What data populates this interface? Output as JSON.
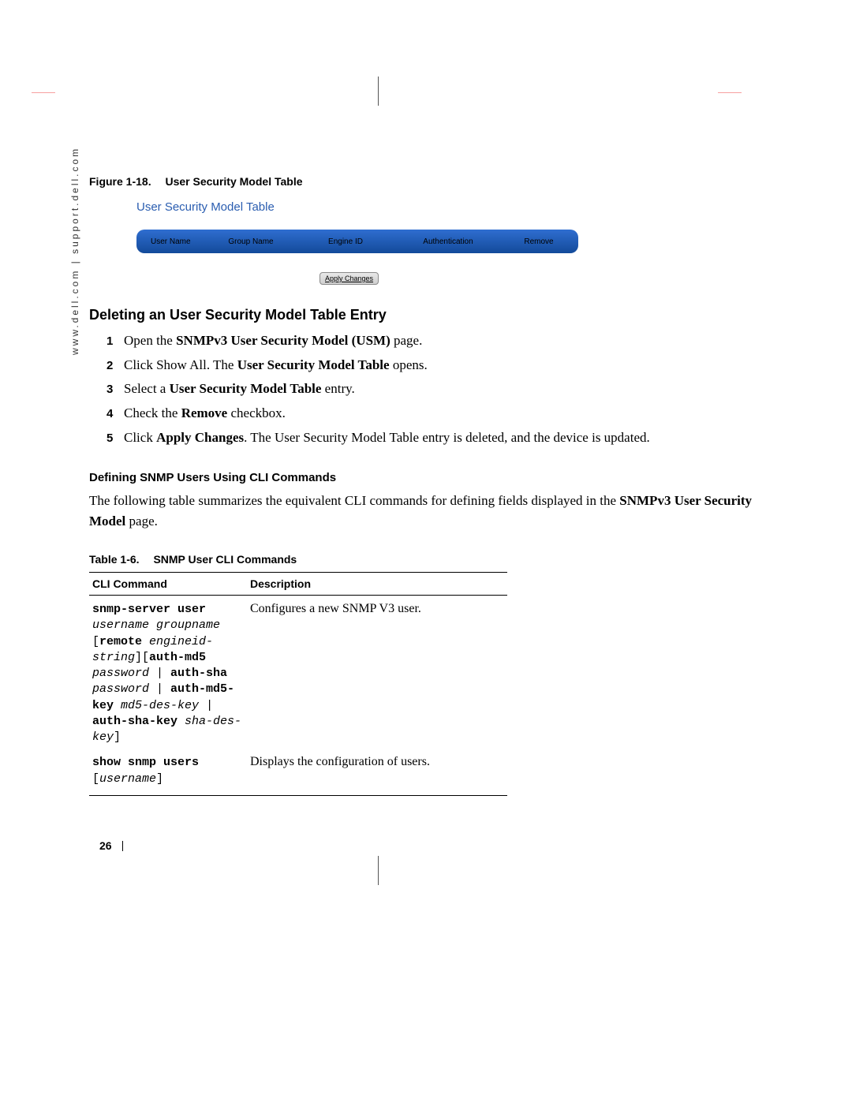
{
  "sidebar_url": "www.dell.com | support.dell.com",
  "figure": {
    "label": "Figure 1-18.",
    "title": "User Security Model Table",
    "panel_title": "User Security Model Table",
    "headers": {
      "user": "User Name",
      "group": "Group Name",
      "engine": "Engine ID",
      "auth": "Authentication",
      "remove": "Remove"
    },
    "apply_label": "Apply Changes"
  },
  "section_heading": "Deleting an User Security Model Table Entry",
  "steps": [
    {
      "n": "1",
      "pre": "Open the ",
      "bold": "SNMPv3 User Security Model (USM)",
      "post": " page."
    },
    {
      "n": "2",
      "pre": "Click Show All. The ",
      "bold": "User Security Model Table",
      "post": " opens."
    },
    {
      "n": "3",
      "pre": "Select a ",
      "bold": "User Security Model Table",
      "post": " entry."
    },
    {
      "n": "4",
      "pre": "Check the ",
      "bold": "Remove",
      "post": " checkbox."
    },
    {
      "n": "5",
      "pre": "Click ",
      "bold": "Apply Changes",
      "post": ". The User Security Model Table entry is deleted, and the device is updated."
    }
  ],
  "subheading": "Defining SNMP Users Using CLI Commands",
  "subpara_pre": "The following table summarizes the equivalent CLI commands for defining fields displayed in the ",
  "subpara_bold": "SNMPv3 User Security Model",
  "subpara_post": " page.",
  "table": {
    "label": "Table 1-6.",
    "title": "SNMP User CLI Commands",
    "col1": "CLI Command",
    "col2": "Description",
    "rows": [
      {
        "desc": "Configures a new SNMP V3 user.",
        "cmd": [
          {
            "t": "kw",
            "v": "snmp-server user"
          },
          {
            "t": "nl"
          },
          {
            "t": "ar",
            "v": "username groupname"
          },
          {
            "t": "nl"
          },
          {
            "t": "tx",
            "v": "["
          },
          {
            "t": "kw",
            "v": "remote"
          },
          {
            "t": "tx",
            "v": " "
          },
          {
            "t": "ar",
            "v": "engineid-"
          },
          {
            "t": "nl"
          },
          {
            "t": "ar",
            "v": "string"
          },
          {
            "t": "tx",
            "v": "]["
          },
          {
            "t": "kw",
            "v": "auth-md5"
          },
          {
            "t": "nl"
          },
          {
            "t": "ar",
            "v": "password"
          },
          {
            "t": "tx",
            "v": " | "
          },
          {
            "t": "kw",
            "v": "auth-sha"
          },
          {
            "t": "nl"
          },
          {
            "t": "ar",
            "v": "password"
          },
          {
            "t": "tx",
            "v": " | "
          },
          {
            "t": "kw",
            "v": "auth-md5-"
          },
          {
            "t": "nl"
          },
          {
            "t": "kw",
            "v": "key"
          },
          {
            "t": "tx",
            "v": " "
          },
          {
            "t": "ar",
            "v": "md5-des-key"
          },
          {
            "t": "tx",
            "v": " |"
          },
          {
            "t": "nl"
          },
          {
            "t": "kw",
            "v": "auth-sha-key"
          },
          {
            "t": "tx",
            "v": " "
          },
          {
            "t": "ar",
            "v": "sha-des-"
          },
          {
            "t": "nl"
          },
          {
            "t": "ar",
            "v": "key"
          },
          {
            "t": "tx",
            "v": "]"
          }
        ]
      },
      {
        "desc": "Displays the configuration of users.",
        "cmd": [
          {
            "t": "kw",
            "v": "show snmp users"
          },
          {
            "t": "nl"
          },
          {
            "t": "tx",
            "v": "["
          },
          {
            "t": "ar",
            "v": "username"
          },
          {
            "t": "tx",
            "v": "]"
          }
        ]
      }
    ]
  },
  "page_number": "26"
}
